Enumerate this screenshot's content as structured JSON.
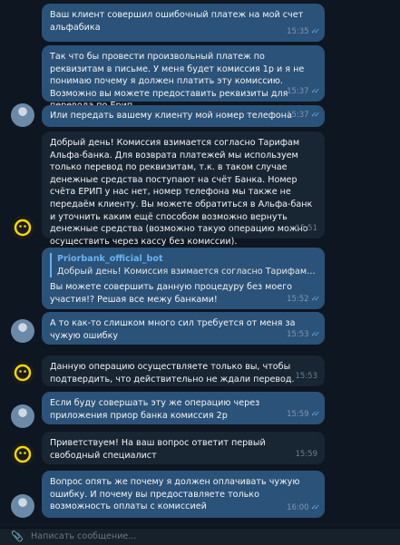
{
  "messages": [
    {
      "dir": "out",
      "text": "Ваш клиент совершил ошибочный платеж на мой счет альфабика",
      "time": "15:35",
      "read": true,
      "avatar": "none"
    },
    {
      "dir": "out",
      "text": "Так что бы провести произвольный платеж по реквизитам в письме. У меня будет комиссия 1р и я не понимаю почему я должен платить эту комиссию. Возможно вы можете предоставить реквизиты для перевода по Ерип",
      "time": "15:37",
      "read": true,
      "avatar": "none"
    },
    {
      "dir": "out",
      "text": "Или передать вашему клиенту мой номер телефона",
      "time": "15:37",
      "read": true,
      "avatar": "user"
    },
    {
      "dir": "in",
      "text": "Добрый день! Комиссия взимается согласно Тарифам Альфа-банка. Для возврата платежей мы используем только перевод по реквизитам, т.к. в таком случае денежные средства поступают на счёт Банка. Номер счёта ЕРИП у нас нет, номер телефона мы также не передаём клиенту. Вы можете обратиться в Альфа-банк и уточнить каким ещё способом возможно вернуть денежные средства (возможно такую операцию можно осуществить через кассу без комиссии).",
      "time": "15:51",
      "avatar": "none"
    },
    {
      "dir": "out",
      "quote_name": "Priorbank_official_bot",
      "quote_text": "Добрый день! Комиссия взимается согласно Тарифам Альфа-...",
      "text": "Вы можете совершить данную процедуру без моего участия!? Решая все межу банками!",
      "time": "15:52",
      "read": true,
      "avatar": "none"
    },
    {
      "dir": "out",
      "text": "А то как-то слишком много сил требуется от меня за чужую ошибку",
      "time": "15:53",
      "read": true,
      "avatar": "user"
    },
    {
      "dir": "in",
      "text": "Данную операцию осуществляете только вы, чтобы подтвердить, что действительно не ждали перевод.",
      "time": "15:53",
      "avatar": "bank"
    },
    {
      "dir": "out",
      "text": "Если буду совершать эту же операцию через приложения приор банка комиссия 2р",
      "time": "15:59",
      "read": true,
      "avatar": "user"
    },
    {
      "dir": "in",
      "text": "Приветствуем! На ваш вопрос ответит первый свободный специалист",
      "time": "15:59",
      "avatar": "bank"
    },
    {
      "dir": "out",
      "text": "Вопрос опять же почему я должен оплачивать чужую ошибку. И почему вы предоставляете только возможность оплаты с комиссией",
      "time": "16:00",
      "read": true,
      "avatar": "user"
    }
  ],
  "input": {
    "placeholder": "Написать сообщение..."
  },
  "icons": {
    "attach": "paperclip-icon",
    "read_receipt": "double-check-icon"
  },
  "colors": {
    "bg": "#0e1621",
    "outgoing": "#2b5278",
    "incoming": "#182533",
    "accent": "#6ab3f3"
  }
}
